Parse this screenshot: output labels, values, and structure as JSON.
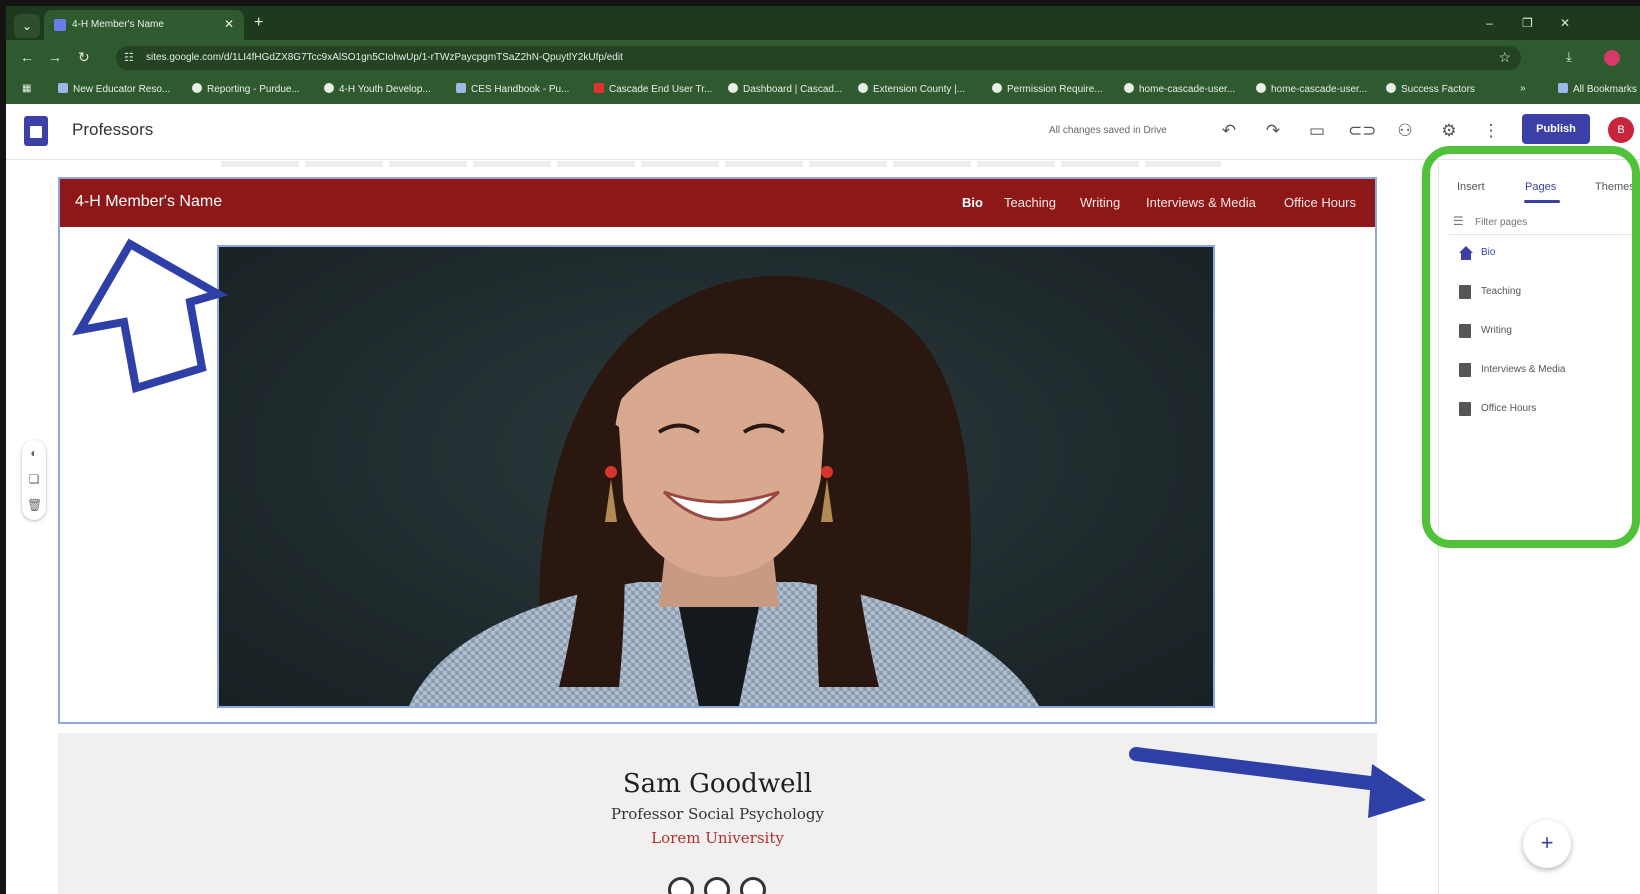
{
  "browser": {
    "tab_title": "4-H Member's Name",
    "url": "sites.google.com/d/1LI4fHGdZX8G7Tcc9xAlSO1gn5CIohwUp/1-rTWzPaycpgmTSaZ2hN-QpuytlY2kUfp/edit",
    "bookmarks": [
      "New Educator Reso...",
      "Reporting - Purdue...",
      "4-H Youth Develop...",
      "CES Handbook - Pu...",
      "Cascade End User Tr...",
      "Dashboard | Cascad...",
      "Extension County |...",
      "Permission Require...",
      "home-cascade-user...",
      "home-cascade-user...",
      "Success Factors"
    ],
    "all_bookmarks": "All Bookmarks"
  },
  "app": {
    "title": "Professors",
    "saved_status": "All changes saved in Drive",
    "publish_label": "Publish",
    "user_initial": "B"
  },
  "site": {
    "name": "4-H Member's Name",
    "nav": [
      "Bio",
      "Teaching",
      "Writing",
      "Interviews & Media",
      "Office Hours"
    ],
    "active_nav": "Bio",
    "person_name": "Sam Goodwell",
    "person_role": "Professor Social Psychology",
    "person_university": "Lorem University"
  },
  "panel": {
    "tabs": [
      "Insert",
      "Pages",
      "Themes"
    ],
    "active_tab": "Pages",
    "filter_placeholder": "Filter pages",
    "pages": [
      "Bio",
      "Teaching",
      "Writing",
      "Interviews & Media",
      "Office Hours"
    ],
    "add_label": "+"
  },
  "colors": {
    "nav_bg": "#8e1717",
    "accent": "#3b3fa6",
    "highlight_green": "#4fc23a",
    "annotation_blue": "#2f3fa8"
  }
}
